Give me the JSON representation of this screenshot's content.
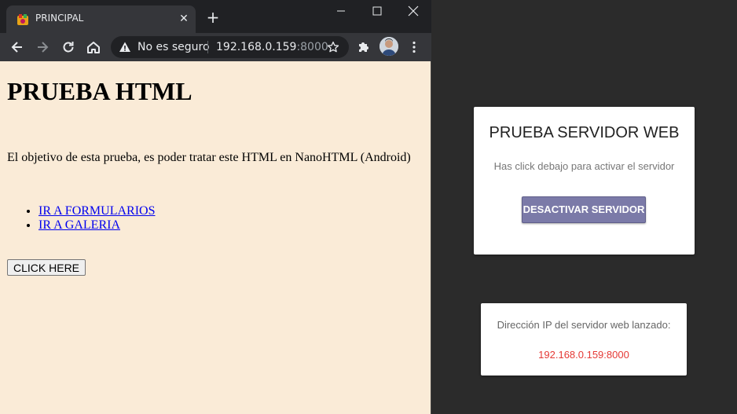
{
  "browser": {
    "tab": {
      "title": "PRINCIPAL"
    },
    "omnibox": {
      "security_label": "No es seguro",
      "url_host": "192.168.0.159",
      "url_port": ":8000"
    },
    "icons": {
      "favicon": "favicon-icon",
      "close_tab": "close-icon",
      "new_tab": "plus-icon",
      "back": "arrow-left-icon",
      "forward": "arrow-right-icon",
      "reload": "reload-icon",
      "home": "home-icon",
      "warning": "warning-icon",
      "bookmark": "star-icon",
      "extensions": "puzzle-icon",
      "menu": "kebab-menu-icon"
    }
  },
  "page": {
    "heading": "PRUEBA HTML",
    "intro": "El objetivo de esta prueba, es poder tratar este HTML en NanoHTML (Android)",
    "links": [
      {
        "label": "IR A FORMULARIOS"
      },
      {
        "label": "IR A GALERIA"
      }
    ],
    "button_label": "CLICK HERE",
    "link_color": "#0000ee",
    "background": "#faebd7"
  },
  "app": {
    "server_card": {
      "title": "PRUEBA SERVIDOR WEB",
      "subtitle": "Has click debajo para activar el servidor",
      "button_label": "DESACTIVAR SERVIDOR",
      "button_color": "#7b7aa8"
    },
    "ip_card": {
      "label": "Dirección IP del servidor web lanzado:",
      "value": "192.168.0.159:8000",
      "value_color": "#e53935"
    }
  }
}
